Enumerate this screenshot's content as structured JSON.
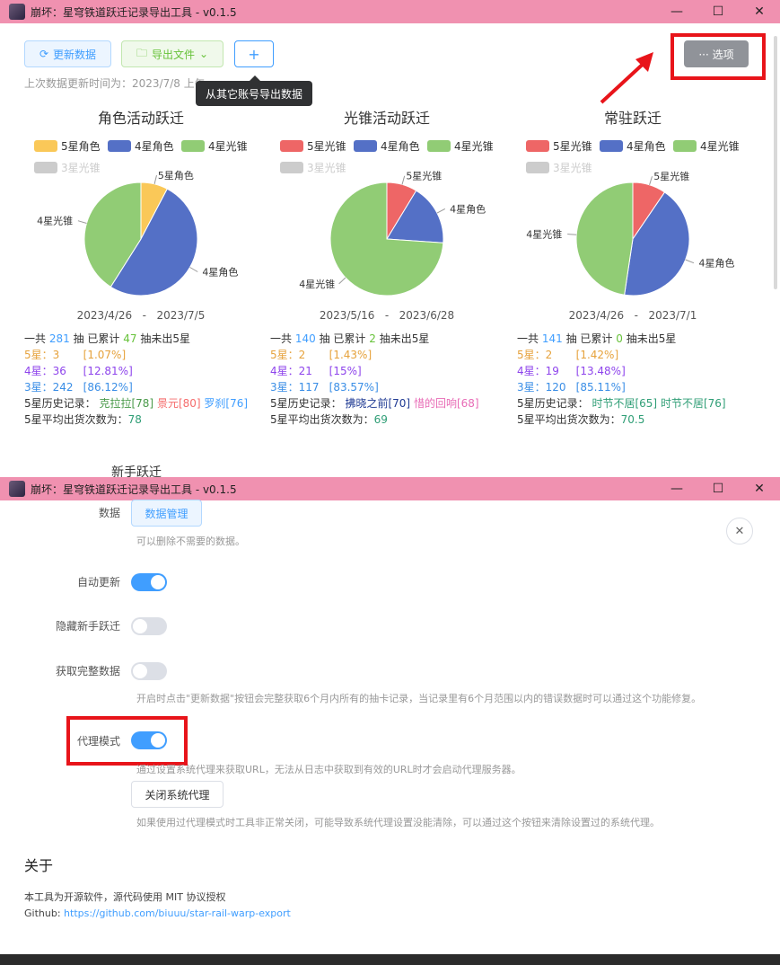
{
  "window_title": "崩坏：星穹铁道跃迁记录导出工具 - v0.1.5",
  "window_controls": {
    "minimize": "—",
    "maximize": "☐",
    "close": "✕"
  },
  "toolbar": {
    "refresh_label": "更新数据",
    "export_label": "导出文件",
    "add_label": "+",
    "options_label": "··· 选项"
  },
  "last_update": "上次数据更新时间为：2023/7/8 上午",
  "tooltip": "从其它账号导出数据",
  "pools": [
    {
      "title": "角色活动跃迁",
      "legend": [
        "5星角色",
        "4星角色",
        "4星光锥",
        "3星光锥"
      ],
      "legend_colors": [
        "#fac858",
        "#5470c6",
        "#91cc75",
        "#cccccc"
      ],
      "chart_labels": [
        "5星角色",
        "4星角色",
        "4星光锥"
      ],
      "dates": {
        "start": "2023/4/26",
        "sep": "-",
        "end": "2023/7/5"
      },
      "total_line": {
        "prefix": "一共",
        "total": "281",
        "mid": "抽 已累计",
        "pity": "47",
        "suffix": "抽未出5星"
      },
      "rows": [
        {
          "label": "5星：",
          "count": "3",
          "pct": "[1.07%]"
        },
        {
          "label": "4星：",
          "count": "36",
          "pct": "[12.81%]"
        },
        {
          "label": "3星：",
          "count": "242",
          "pct": "[86.12%]"
        }
      ],
      "history_label": "5星历史记录：",
      "history": [
        "克拉拉[78]",
        "景元[80]",
        "罗刹[76]"
      ],
      "avg_label": "5星平均出货次数为：",
      "avg": "78"
    },
    {
      "title": "光锥活动跃迁",
      "legend": [
        "5星光锥",
        "4星角色",
        "4星光锥",
        "3星光锥"
      ],
      "legend_colors": [
        "#ee6666",
        "#5470c6",
        "#91cc75",
        "#cccccc"
      ],
      "chart_labels": [
        "5星光锥",
        "4星角色",
        "4星光锥"
      ],
      "dates": {
        "start": "2023/5/16",
        "sep": "-",
        "end": "2023/6/28"
      },
      "total_line": {
        "prefix": "一共",
        "total": "140",
        "mid": "抽 已累计",
        "pity": "2",
        "suffix": "抽未出5星"
      },
      "rows": [
        {
          "label": "5星：",
          "count": "2",
          "pct": "[1.43%]"
        },
        {
          "label": "4星：",
          "count": "21",
          "pct": "[15%]"
        },
        {
          "label": "3星：",
          "count": "117",
          "pct": "[83.57%]"
        }
      ],
      "history_label": "5星历史记录：",
      "history": [
        "拂晓之前[70]",
        "惜的回响[68]"
      ],
      "avg_label": "5星平均出货次数为：",
      "avg": "69"
    },
    {
      "title": "常驻跃迁",
      "legend": [
        "5星光锥",
        "4星角色",
        "4星光锥",
        "3星光锥"
      ],
      "legend_colors": [
        "#ee6666",
        "#5470c6",
        "#91cc75",
        "#cccccc"
      ],
      "chart_labels": [
        "5星光锥",
        "4星光锥",
        "4星角色"
      ],
      "dates": {
        "start": "2023/4/26",
        "sep": "-",
        "end": "2023/7/1"
      },
      "total_line": {
        "prefix": "一共",
        "total": "141",
        "mid": "抽 已累计",
        "pity": "0",
        "suffix": "抽未出5星"
      },
      "rows": [
        {
          "label": "5星：",
          "count": "2",
          "pct": "[1.42%]"
        },
        {
          "label": "4星：",
          "count": "19",
          "pct": "[13.48%]"
        },
        {
          "label": "3星：",
          "count": "120",
          "pct": "[85.11%]"
        }
      ],
      "history_label": "5星历史记录：",
      "history": [
        "时节不居[65]",
        "时节不居[76]"
      ],
      "avg_label": "5星平均出货次数为：",
      "avg": "70.5"
    }
  ],
  "newbie_title": "新手跃迁",
  "chart_data": [
    {
      "type": "pie",
      "title": "角色活动跃迁",
      "categories": [
        "5星角色",
        "4星角色",
        "4星光锥"
      ],
      "values": [
        3,
        20,
        16
      ]
    },
    {
      "type": "pie",
      "title": "光锥活动跃迁",
      "categories": [
        "5星光锥",
        "4星角色",
        "4星光锥"
      ],
      "values": [
        2,
        4,
        17
      ]
    },
    {
      "type": "pie",
      "title": "常驻跃迁",
      "categories": [
        "5星光锥",
        "4星角色",
        "4星光锥"
      ],
      "values": [
        2,
        9,
        10
      ]
    }
  ],
  "settings": {
    "data_label": "数据",
    "data_manage_button": "数据管理",
    "data_desc": "可以删除不需要的数据。",
    "auto_update_label": "自动更新",
    "auto_update": true,
    "hide_newbie_label": "隐藏新手跃迁",
    "hide_newbie": false,
    "full_data_label": "获取完整数据",
    "full_data": false,
    "full_data_desc": "开启时点击\"更新数据\"按钮会完整获取6个月内所有的抽卡记录，当记录里有6个月范围以内的错误数据时可以通过这个功能修复。",
    "proxy_label": "代理模式",
    "proxy": true,
    "proxy_desc": "通过设置系统代理来获取URL，无法从日志中获取到有效的URL时才会启动代理服务器。",
    "close_proxy_button": "关闭系统代理",
    "close_proxy_desc": "如果使用过代理模式时工具非正常关闭，可能导致系统代理设置没能清除，可以通过这个按钮来清除设置过的系统代理。"
  },
  "about": {
    "title": "关于",
    "license": "本工具为开源软件，源代码使用 MIT 协议授权",
    "github_label": "Github:",
    "github_url": "https://github.com/biuuu/star-rail-warp-export"
  }
}
